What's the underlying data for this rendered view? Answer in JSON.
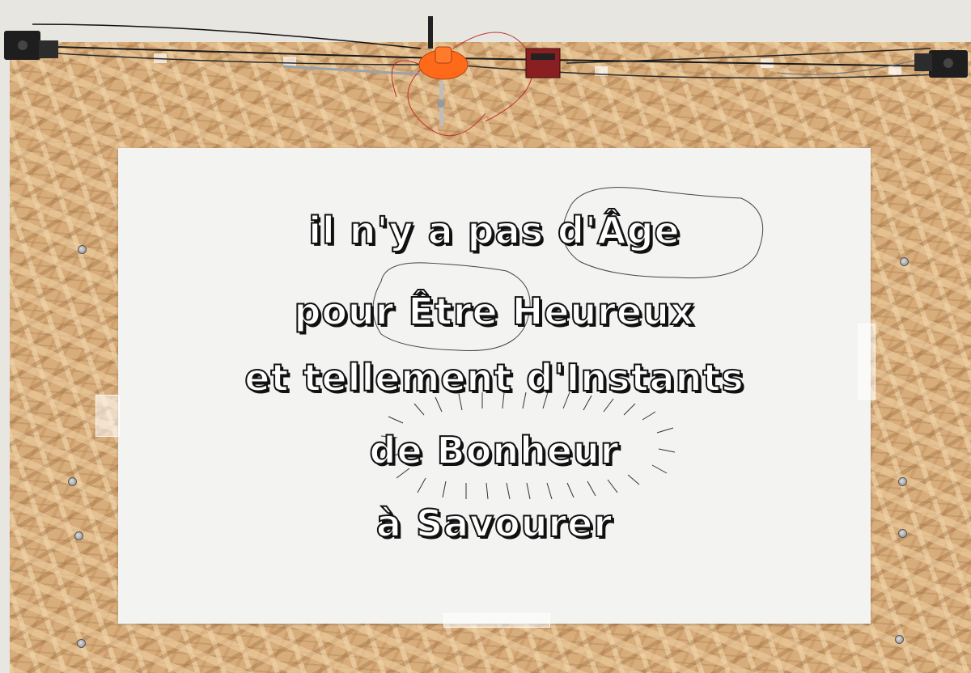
{
  "poster": {
    "line1": "il n'y a pas d'Âge",
    "line2": "pour Être  Heureux",
    "line3": "et tellement d'Instants",
    "line4": "de  Bonheur",
    "line5": "à Savourer"
  },
  "colors": {
    "board": "#d8ad7c",
    "paper": "#f3f3f1",
    "ink": "#111111",
    "gondola": "#ff6a1a"
  },
  "icons": {
    "left_motor": "stepper-motor-icon",
    "right_motor": "stepper-motor-icon",
    "gondola": "pen-gondola-icon",
    "controller": "circuit-board-icon"
  }
}
